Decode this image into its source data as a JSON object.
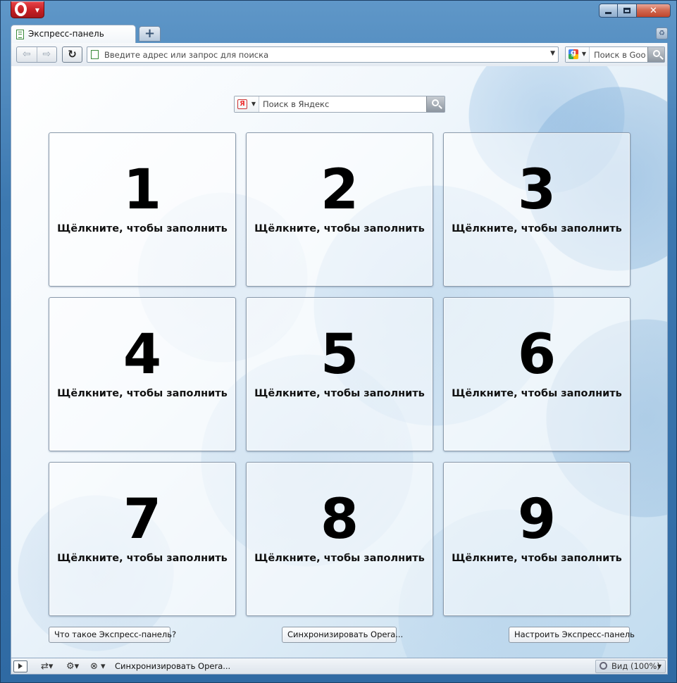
{
  "window": {
    "tab_title": "Экспресс-панель",
    "new_tab_symbol": "+",
    "caption": {
      "minimize_symbol": "",
      "maximize_symbol": "",
      "close_symbol": "✕"
    }
  },
  "toolbar": {
    "address_placeholder": "Введите адрес или запрос для поиска",
    "search_placeholder": "Поиск в Goog",
    "back_symbol": "⇦",
    "forward_symbol": "⇨",
    "reload_symbol": "↻"
  },
  "speed_dial": {
    "search_placeholder": "Поиск в Яндекс",
    "search_engine_letter": "Я",
    "tiles": [
      {
        "number": "1",
        "label": "Щёлкните, чтобы заполнить"
      },
      {
        "number": "2",
        "label": "Щёлкните, чтобы заполнить"
      },
      {
        "number": "3",
        "label": "Щёлкните, чтобы заполнить"
      },
      {
        "number": "4",
        "label": "Щёлкните, чтобы заполнить"
      },
      {
        "number": "5",
        "label": "Щёлкните, чтобы заполнить"
      },
      {
        "number": "6",
        "label": "Щёлкните, чтобы заполнить"
      },
      {
        "number": "7",
        "label": "Щёлкните, чтобы заполнить"
      },
      {
        "number": "8",
        "label": "Щёлкните, чтобы заполнить"
      },
      {
        "number": "9",
        "label": "Щёлкните, чтобы заполнить"
      }
    ],
    "buttons": {
      "what_is": "Что такое Экспресс-панель?",
      "sync": "Синхронизировать Opera...",
      "setup": "Настроить Экспресс-панель"
    }
  },
  "statusbar": {
    "sync_label": "Синхронизировать Opera...",
    "view_label": "Вид (100%)"
  },
  "colors": {
    "opera_red": "#c51f24",
    "frame_blue": "#3c78b0"
  }
}
